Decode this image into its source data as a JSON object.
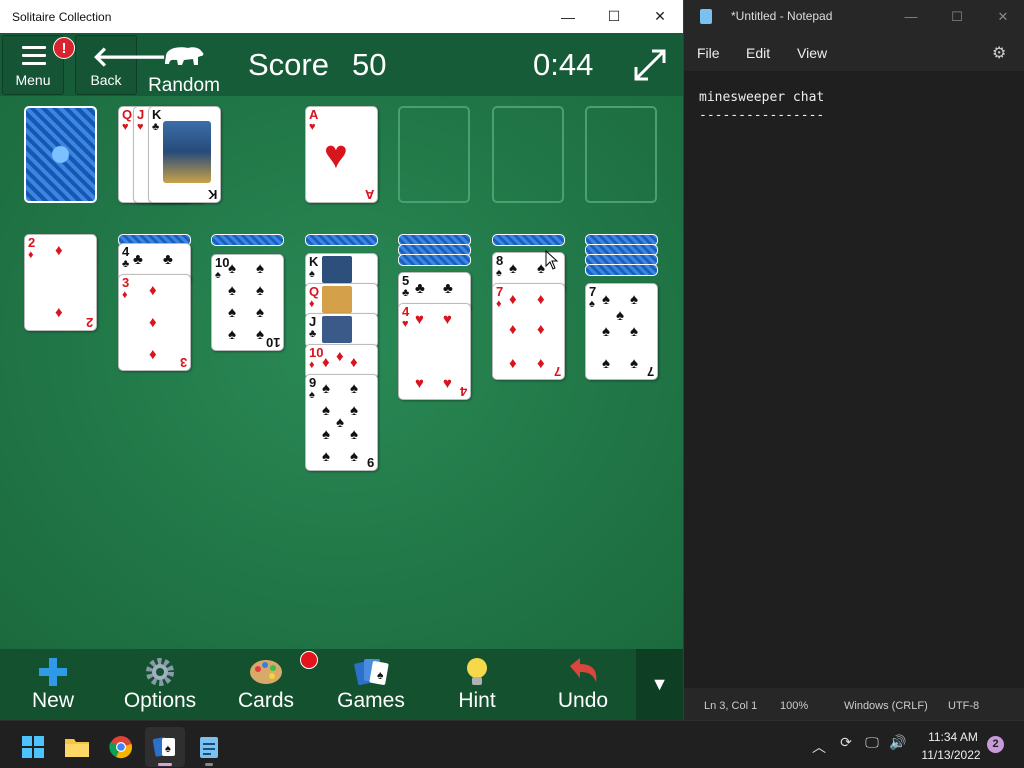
{
  "solitaire": {
    "title": "Solitaire Collection",
    "header": {
      "menu_label": "Menu",
      "menu_alert": "!",
      "back_label": "Back",
      "mode_label": "Random",
      "score_label": "Score",
      "score_value": "50",
      "timer": "0:44"
    },
    "toolbar": {
      "new": "New",
      "options": "Options",
      "cards": "Cards",
      "games": "Games",
      "hint": "Hint",
      "undo": "Undo"
    }
  },
  "cards": {
    "waste": [
      {
        "rank": "Q",
        "suit": "♥"
      },
      {
        "rank": "J",
        "suit": "♥"
      },
      {
        "rank": "K",
        "suit": "♣"
      }
    ],
    "foundation": [
      {
        "rank": "A",
        "suit": "♥"
      }
    ],
    "tableau": [
      {
        "faces": [
          {
            "rank": "2",
            "suit": "♦"
          }
        ]
      },
      {
        "faces": [
          {
            "rank": "4",
            "suit": "♣"
          },
          {
            "rank": "3",
            "suit": "♦"
          }
        ]
      },
      {
        "faces": [
          {
            "rank": "10",
            "suit": "♠"
          }
        ]
      },
      {
        "faces": [
          {
            "rank": "K",
            "suit": "♠"
          },
          {
            "rank": "Q",
            "suit": "♦"
          },
          {
            "rank": "J",
            "suit": "♣"
          },
          {
            "rank": "10",
            "suit": "♦"
          },
          {
            "rank": "9",
            "suit": "♠"
          }
        ]
      },
      {
        "faces": [
          {
            "rank": "5",
            "suit": "♣"
          },
          {
            "rank": "4",
            "suit": "♥"
          }
        ]
      },
      {
        "faces": [
          {
            "rank": "8",
            "suit": "♠"
          },
          {
            "rank": "7",
            "suit": "♦"
          }
        ]
      },
      {
        "faces": [
          {
            "rank": "7",
            "suit": "♠"
          }
        ]
      }
    ]
  },
  "notepad": {
    "title": "*Untitled - Notepad",
    "menu": [
      "File",
      "Edit",
      "View"
    ],
    "text": "minesweeper chat\n----------------",
    "status": {
      "position": "Ln 3, Col 1",
      "zoom": "100%",
      "line_ending": "Windows (CRLF)",
      "encoding": "UTF-8"
    }
  },
  "taskbar": {
    "time": "11:34 AM",
    "date": "11/13/2022",
    "notifications": "2"
  }
}
